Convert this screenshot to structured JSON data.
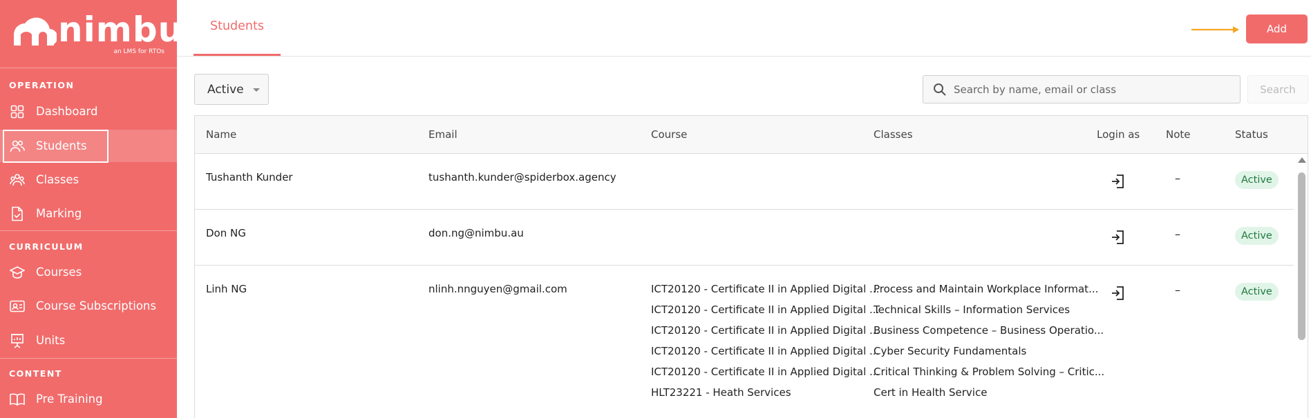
{
  "brand": {
    "name": "nimbu",
    "tagline": "an LMS for RTOs"
  },
  "sidebar": {
    "sections": [
      {
        "title": "OPERATION"
      },
      {
        "title": "CURRICULUM"
      },
      {
        "title": "CONTENT"
      }
    ],
    "items": [
      {
        "label": "Dashboard",
        "icon": "dashboard-grid-icon"
      },
      {
        "label": "Students",
        "icon": "users-icon",
        "active": true
      },
      {
        "label": "Classes",
        "icon": "group-icon"
      },
      {
        "label": "Marking",
        "icon": "document-check-icon"
      },
      {
        "label": "Courses",
        "icon": "graduation-cap-icon"
      },
      {
        "label": "Course Subscriptions",
        "icon": "id-card-icon"
      },
      {
        "label": "Units",
        "icon": "presentation-icon"
      },
      {
        "label": "Pre Training",
        "icon": "book-icon"
      }
    ]
  },
  "header": {
    "tab_label": "Students",
    "add_label": "Add"
  },
  "filters": {
    "status_value": "Active",
    "search_placeholder": "Search by name, email or class",
    "search_button": "Search"
  },
  "table": {
    "columns": [
      "Name",
      "Email",
      "Course",
      "Classes",
      "Login as",
      "Note",
      "Status"
    ],
    "rows": [
      {
        "name": "Tushanth Kunder",
        "email": "tushanth.kunder@spiderbox.agency",
        "courses": [],
        "classes": [],
        "note": "–",
        "status": "Active"
      },
      {
        "name": "Don NG",
        "email": "don.ng@nimbu.au",
        "courses": [],
        "classes": [],
        "note": "–",
        "status": "Active"
      },
      {
        "name": "Linh NG",
        "email": "nlinh.nnguyen@gmail.com",
        "courses": [
          "ICT20120 - Certificate II in Applied Digital ...",
          "ICT20120 - Certificate II in Applied Digital ...",
          "ICT20120 - Certificate II in Applied Digital ...",
          "ICT20120 - Certificate II in Applied Digital ...",
          "ICT20120 - Certificate II in Applied Digital ...",
          "HLT23221 - Heath Services"
        ],
        "classes": [
          "Process and Maintain Workplace Informat...",
          "Technical Skills – Information Services",
          "Business Competence – Business Operatio...",
          "Cyber Security Fundamentals",
          "Critical Thinking & Problem Solving – Critic...",
          "Cert in Health Service"
        ],
        "note": "–",
        "status": "Active"
      }
    ]
  },
  "colors": {
    "brand": "#f16b6b",
    "status_bg": "#e1f4e8",
    "status_text": "#1f7a3f",
    "arrow": "#f5a623"
  }
}
